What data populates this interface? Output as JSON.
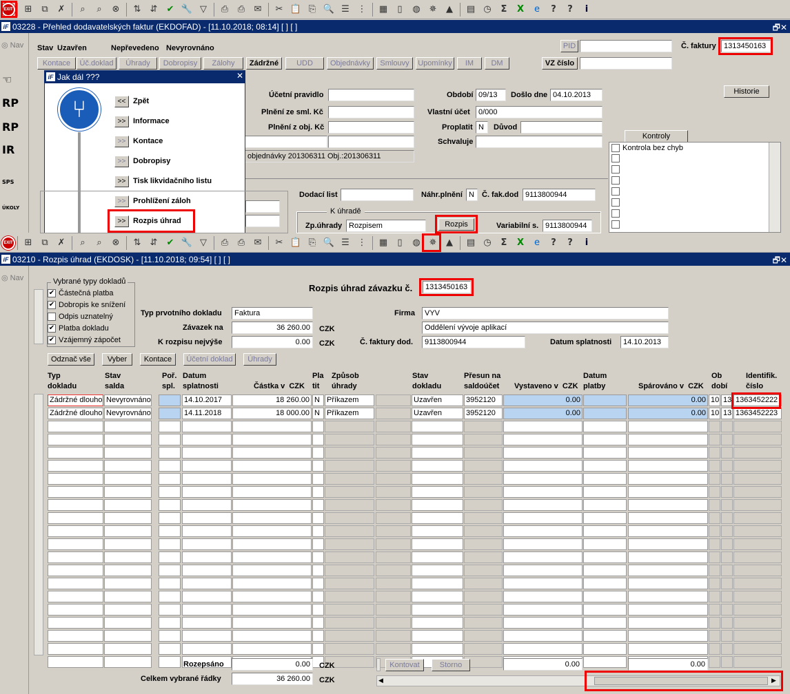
{
  "toolbar_top": {
    "exit_label": "EXIT"
  },
  "win1": {
    "title": "03228 - Přehled dodavatelských faktur (EKDOFAD) - [11.10.2018; 08:14]  [ ]  [ ]",
    "nav": "Nav",
    "stav_label": "Stav",
    "stav_value": "Uzavřen",
    "neprevedeno": "Nepřevedeno",
    "nevyrovnano": "Nevyrovnáno",
    "pid_label": "PID",
    "cfaktury_label": "Č. faktury",
    "cfaktury_value": "1313450163",
    "vzcislo_label": "VZ číslo",
    "tabs": [
      "Kontace",
      "Úč.doklad",
      "Úhrady",
      "Dobropisy",
      "Zálohy",
      "Zádržné",
      "UDD",
      "Objednávky",
      "Smlouvy",
      "Upomínky",
      "IM",
      "DM"
    ],
    "ucetni_pravidlo": "Účetní pravidlo",
    "plneni_sml": "Plnění ze sml. Kč",
    "plneni_obj": "Plnění z obj. Kč",
    "obdobi_label": "Období",
    "obdobi_value": "09/13",
    "doslo_label": "Došlo dne",
    "doslo_value": "04.10.2013",
    "vlastni_ucet_label": "Vlastní účet",
    "vlastni_ucet_value": "0/000",
    "proplatit_label": "Proplatit",
    "proplatit_value": "N",
    "duvod_label": "Důvod",
    "schvaluje_label": "Schvaluje",
    "objednavky_text": "objednávky 201306311 Obj.:201306311",
    "historie": "Historie",
    "kontroly": "Kontroly",
    "kontrola_bez_chyb": "Kontrola bez chyb",
    "dodaci_list": "Dodací list",
    "nahr_plneni": "Náhr.plnění",
    "nahr_plneni_value": "N",
    "cfakdod_label": "Č. fak.dod",
    "cfakdod_value": "9113800944",
    "k_uhrade": "K úhradě",
    "zpuhrady_label": "Zp.úhrady",
    "zpuhrady_value": "Rozpisem",
    "rozpis_btn": "Rozpis",
    "variabilni_label": "Variabilní s.",
    "variabilni_value": "9113800944"
  },
  "sidebar": {
    "items": [
      "RP",
      "RP",
      "IR",
      "SPS",
      "ÚKOLY"
    ]
  },
  "popup": {
    "title": "Jak dál ???",
    "items": [
      {
        "icon": "<<",
        "label": "Zpět"
      },
      {
        "icon": ">>",
        "label": "Informace"
      },
      {
        "icon": ">>",
        "label": "Kontace"
      },
      {
        "icon": ">>",
        "label": "Dobropisy"
      },
      {
        "icon": ">>",
        "label": "Tisk likvidačního listu"
      },
      {
        "icon": ">>",
        "label": "Prohlížení záloh"
      },
      {
        "icon": ">>",
        "label": "Rozpis úhrad"
      }
    ]
  },
  "win2": {
    "title": "03210 - Rozpis úhrad (EKDOSK) - [11.10.2018; 09:54]  [ ]  [ ]",
    "nav": "Nav",
    "vybrane_typy_title": "Vybrané typy dokladů",
    "typy": [
      {
        "label": "Částečná platba",
        "checked": true
      },
      {
        "label": "Dobropis ke snížení",
        "checked": true
      },
      {
        "label": "Odpis uznatelný",
        "checked": false
      },
      {
        "label": "Platba dokladu",
        "checked": true
      },
      {
        "label": "Vzájemný zápočet",
        "checked": true
      }
    ],
    "heading": "Rozpis úhrad závazku č.",
    "heading_value": "1313450163",
    "typ_prvotniho_label": "Typ prvotního dokladu",
    "typ_prvotniho_value": "Faktura",
    "zavazek_label": "Závazek na",
    "zavazek_value": "36 260.00",
    "k_rozpisu_label": "K rozpisu nejvýše",
    "k_rozpisu_value": "0.00",
    "czk": "CZK",
    "firma_label": "Firma",
    "firma_value": "VYV",
    "oddeleni_value": "Oddělení vývoje aplikací",
    "cfaktury_dod_label": "Č. faktury dod.",
    "cfaktury_dod_value": "9113800944",
    "datum_splatnosti_label": "Datum splatnosti",
    "datum_splatnosti_value": "14.10.2013",
    "buttons": [
      "Odznač vše",
      "Vyber",
      "Kontace",
      "Účetní doklad",
      "Úhrady"
    ],
    "columns": [
      "Typ\ndokladu",
      "Stav\nsalda",
      "Poř.\nspl.",
      "Datum\nsplatnosti",
      "Částka v  CZK",
      "Pla\ntit",
      "Způsob\núhrady",
      "Stav\ndokladu",
      "Přesun na\nsaldoúčet",
      "Vystaveno v  CZK",
      "Datum\nplatby",
      "Spárováno v  CZK",
      "Ob\ndobí",
      "Identifik.\nčíslo"
    ],
    "rows": [
      {
        "typ": "Zádržné dlouho",
        "stav": "Nevyrovnáno",
        "por": "",
        "datum": "14.10.2017",
        "castka": "18 260.00",
        "platit": "N",
        "zpusob": "Příkazem",
        "stav_dokladu": "Uzavřen",
        "presun": "3952120",
        "vystaveno": "0.00",
        "datum_platby": "",
        "sparovano": "0.00",
        "ob1": "10",
        "ob2": "13",
        "ident": "1363452222"
      },
      {
        "typ": "Zádržné dlouho",
        "stav": "Nevyrovnáno",
        "por": "",
        "datum": "14.11.2018",
        "castka": "18 000.00",
        "platit": "N",
        "zpusob": "Příkazem",
        "stav_dokladu": "Uzavřen",
        "presun": "3952120",
        "vystaveno": "0.00",
        "datum_platby": "",
        "sparovano": "0.00",
        "ob1": "10",
        "ob2": "13",
        "ident": "1363452223"
      }
    ],
    "rozepsano_label": "Rozepsáno",
    "rozepsano_value": "0.00",
    "celkem_label": "Celkem vybrané řádky",
    "celkem_value": "36 260.00",
    "kontovat": "Kontovat",
    "storno": "Storno",
    "vystaveno_total": "0.00",
    "sparovano_total": "0.00"
  }
}
